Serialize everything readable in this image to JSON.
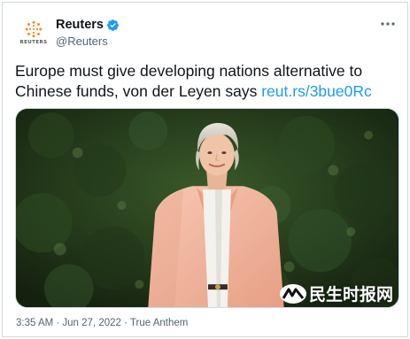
{
  "tweet": {
    "author": {
      "display_name": "Reuters",
      "handle": "@Reuters",
      "verified": true,
      "avatar_wordmark": "REUTERS"
    },
    "text": "Europe must give developing nations alternative to Chinese funds, von der Leyen says ",
    "link_text": "reut.rs/3bue0Rc",
    "timestamp": "3:35 AM · Jun 27, 2022 · True Anthem",
    "media_watermark": "民生时报网"
  },
  "colors": {
    "link": "#1d9bf0",
    "verified_badge": "#1d9bf0",
    "secondary_text": "#536471",
    "border": "#cfd9de",
    "jacket": "#f3b9a3",
    "foliage": "#1f3319"
  },
  "icons": {
    "verified": "verified-badge-icon",
    "more": "more-options-icon",
    "avatar": "reuters-logo-icon"
  }
}
